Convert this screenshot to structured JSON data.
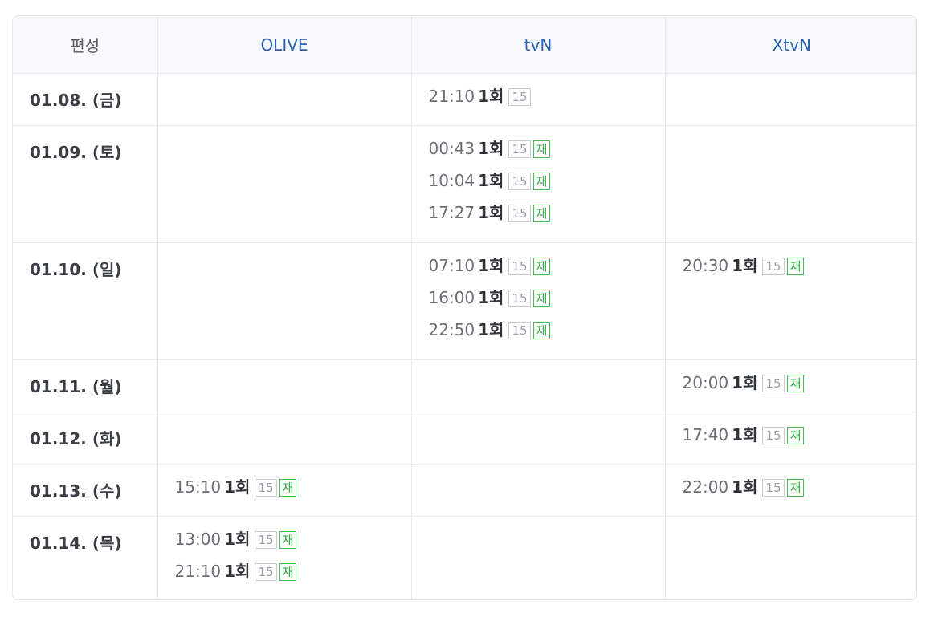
{
  "header": {
    "col0": "편성",
    "col1": "OLIVE",
    "col2": "tvN",
    "col3": "XtvN"
  },
  "rows": [
    {
      "date": "01.08. (금)",
      "olive": [],
      "tvn": [
        {
          "time": "21:10",
          "ep": "1회",
          "rating": "15",
          "re": ""
        }
      ],
      "xtvn": []
    },
    {
      "date": "01.09. (토)",
      "olive": [],
      "tvn": [
        {
          "time": "00:43",
          "ep": "1회",
          "rating": "15",
          "re": "재"
        },
        {
          "time": "10:04",
          "ep": "1회",
          "rating": "15",
          "re": "재"
        },
        {
          "time": "17:27",
          "ep": "1회",
          "rating": "15",
          "re": "재"
        }
      ],
      "xtvn": []
    },
    {
      "date": "01.10. (일)",
      "olive": [],
      "tvn": [
        {
          "time": "07:10",
          "ep": "1회",
          "rating": "15",
          "re": "재"
        },
        {
          "time": "16:00",
          "ep": "1회",
          "rating": "15",
          "re": "재"
        },
        {
          "time": "22:50",
          "ep": "1회",
          "rating": "15",
          "re": "재"
        }
      ],
      "xtvn": [
        {
          "time": "20:30",
          "ep": "1회",
          "rating": "15",
          "re": "재"
        }
      ]
    },
    {
      "date": "01.11. (월)",
      "olive": [],
      "tvn": [],
      "xtvn": [
        {
          "time": "20:00",
          "ep": "1회",
          "rating": "15",
          "re": "재"
        }
      ]
    },
    {
      "date": "01.12. (화)",
      "olive": [],
      "tvn": [],
      "xtvn": [
        {
          "time": "17:40",
          "ep": "1회",
          "rating": "15",
          "re": "재"
        }
      ]
    },
    {
      "date": "01.13. (수)",
      "olive": [
        {
          "time": "15:10",
          "ep": "1회",
          "rating": "15",
          "re": "재"
        }
      ],
      "tvn": [],
      "xtvn": [
        {
          "time": "22:00",
          "ep": "1회",
          "rating": "15",
          "re": "재"
        }
      ]
    },
    {
      "date": "01.14. (목)",
      "olive": [
        {
          "time": "13:00",
          "ep": "1회",
          "rating": "15",
          "re": "재"
        },
        {
          "time": "21:10",
          "ep": "1회",
          "rating": "15",
          "re": "재"
        }
      ],
      "tvn": [],
      "xtvn": []
    }
  ]
}
